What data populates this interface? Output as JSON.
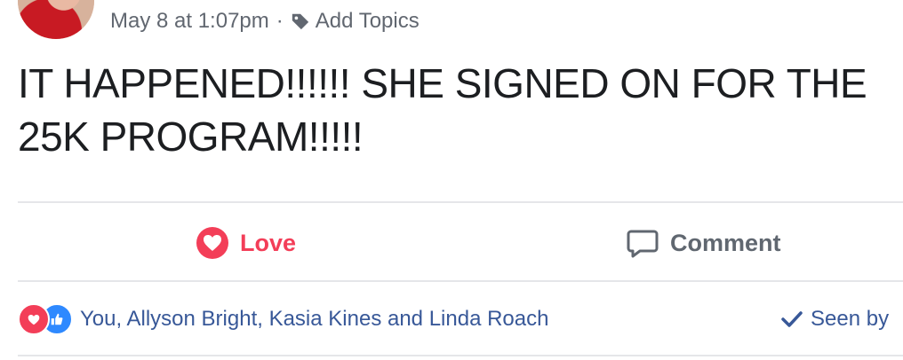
{
  "post": {
    "timestamp": "May 8 at 1:07pm",
    "separator": "·",
    "add_topics_label": "Add Topics",
    "text_line1": "IT HAPPENED!!!!!! SHE SIGNED ON FOR THE",
    "text_line2": "25K PROGRAM!!!!!"
  },
  "actions": {
    "love_label": "Love",
    "comment_label": "Comment"
  },
  "reactions": {
    "names": "You, Allyson Bright, Kasia Kines and Linda Roach",
    "seen_label": "Seen by",
    "icons": [
      "love-icon",
      "like-icon"
    ]
  },
  "colors": {
    "love": "#f33e58",
    "like": "#2e89ff",
    "link": "#385898",
    "meta": "#616770"
  }
}
